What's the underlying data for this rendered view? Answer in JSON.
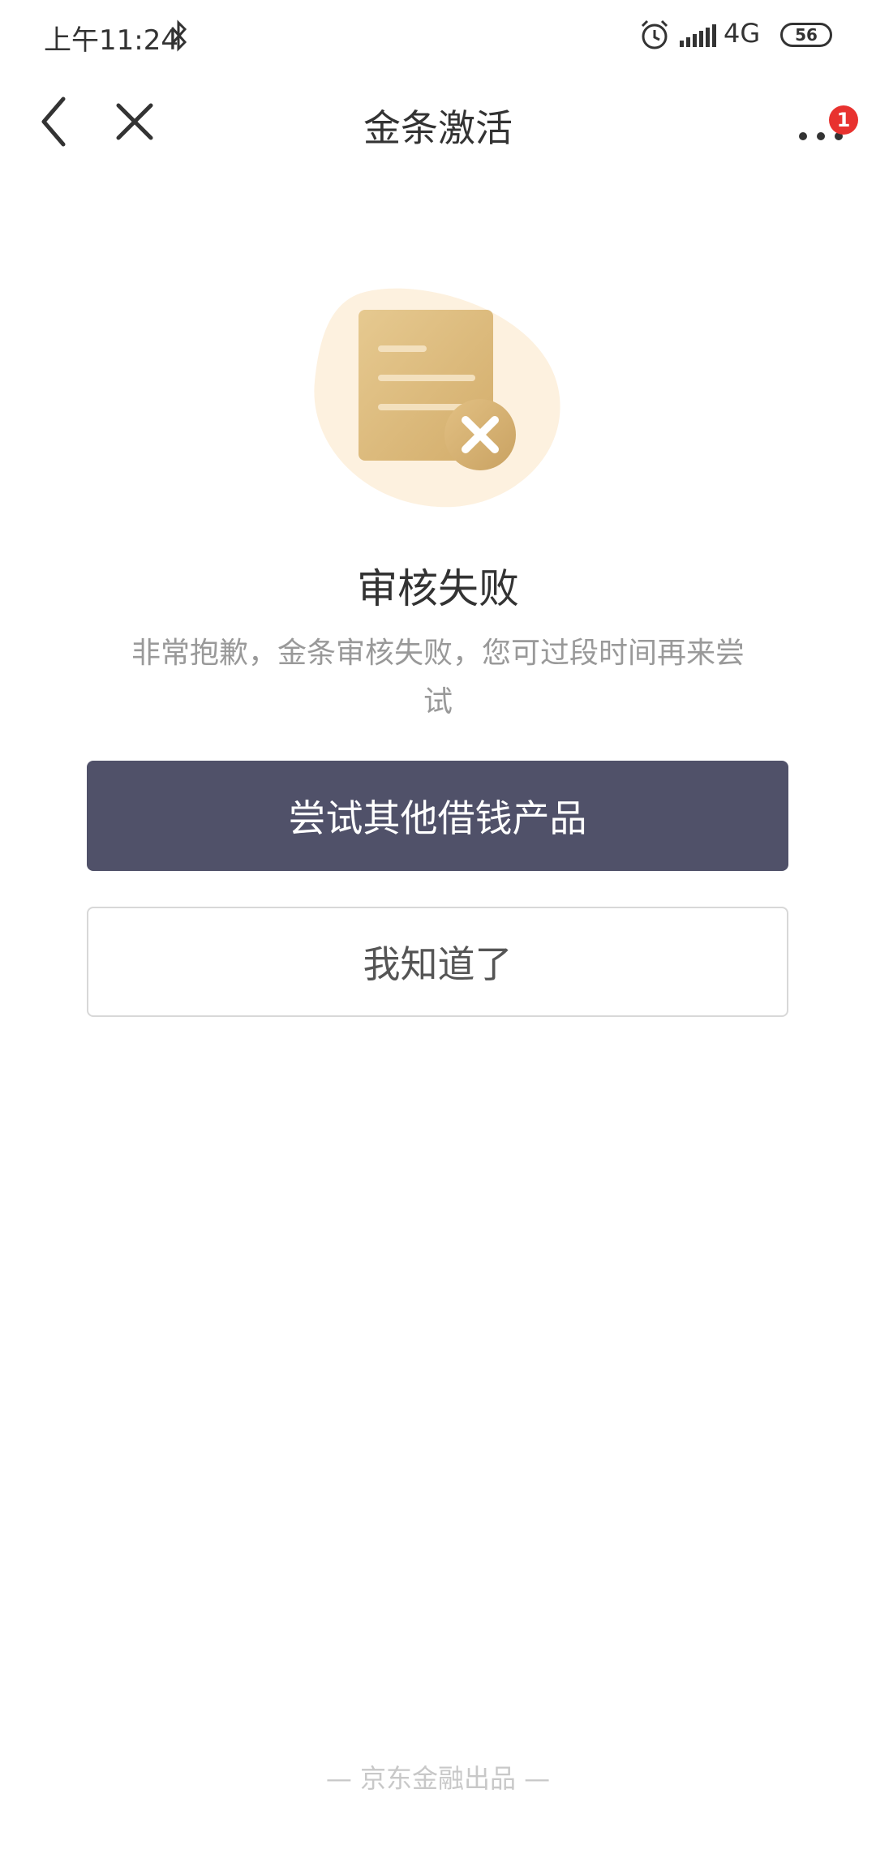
{
  "status_bar": {
    "time": "上午11:24",
    "network": "4G",
    "battery": "56",
    "icons": [
      "bluetooth-icon",
      "alarm-icon",
      "signal-icon",
      "battery-icon"
    ]
  },
  "nav": {
    "title": "金条激活",
    "badge_count": "1",
    "icons": [
      "back-arrow-icon",
      "close-icon",
      "more-icon"
    ]
  },
  "result": {
    "illustration": "document-error-icon",
    "title": "审核失败",
    "description": "非常抱歉，金条审核失败，您可过段时间再来尝试"
  },
  "actions": {
    "primary_label": "尝试其他借钱产品",
    "secondary_label": "我知道了"
  },
  "footer": {
    "text": "— 京东金融出品 —"
  },
  "colors": {
    "primary_button": "#505169",
    "badge": "#e8322f",
    "illustration_gold": "#d9b877"
  }
}
